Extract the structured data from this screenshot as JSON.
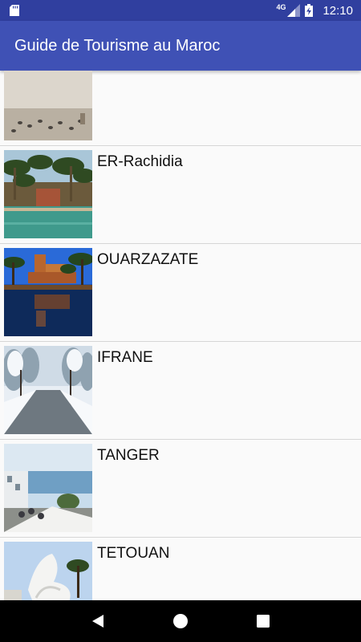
{
  "status_bar": {
    "network": "4G",
    "time": "12:10",
    "icons": [
      "sd-card-icon",
      "signal-icon",
      "battery-charging-icon"
    ]
  },
  "app_bar": {
    "title": "Guide de Tourisme au Maroc"
  },
  "list": {
    "items": [
      {
        "label": "",
        "image": "plaza-with-pigeons"
      },
      {
        "label": "ER-Rachidia",
        "image": "oasis-pool-with-palms"
      },
      {
        "label": "OUARZAZATE",
        "image": "kasbah-reflection-pool"
      },
      {
        "label": "IFRANE",
        "image": "snowy-tree-lined-road"
      },
      {
        "label": "TANGER",
        "image": "coastal-terrace-sea-view"
      },
      {
        "label": "TETOUAN",
        "image": "white-dove-sculpture"
      }
    ]
  },
  "nav_bar": {
    "icons": [
      "back-icon",
      "home-icon",
      "recents-icon"
    ]
  }
}
